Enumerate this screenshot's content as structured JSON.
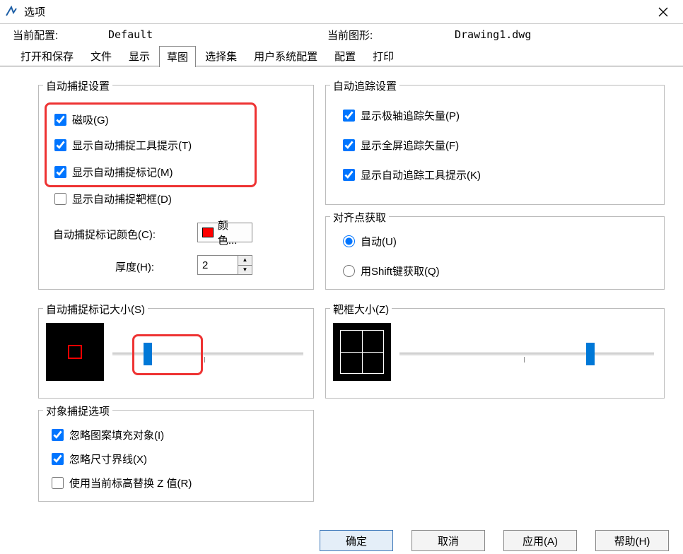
{
  "title": "选项",
  "config": {
    "label_current_profile": "当前配置:",
    "current_profile": "Default",
    "label_current_drawing": "当前图形:",
    "current_drawing": "Drawing1.dwg"
  },
  "tabs": [
    "打开和保存",
    "文件",
    "显示",
    "草图",
    "选择集",
    "用户系统配置",
    "配置",
    "打印"
  ],
  "active_tab": "草图",
  "group_autosnap": {
    "legend": "自动捕捉设置",
    "cb_magnet": "磁吸(G)",
    "cb_tooltip": "显示自动捕捉工具提示(T)",
    "cb_marker": "显示自动捕捉标记(M)",
    "cb_aperture": "显示自动捕捉靶框(D)",
    "label_color": "自动捕捉标记颜色(C):",
    "btn_color": "颜色...",
    "label_thickness": "厚度(H):",
    "thickness_value": "2"
  },
  "group_autotrack": {
    "legend": "自动追踪设置",
    "cb_polar": "显示极轴追踪矢量(P)",
    "cb_fullscreen": "显示全屏追踪矢量(F)",
    "cb_track_tooltip": "显示自动追踪工具提示(K)"
  },
  "group_align": {
    "legend": "对齐点获取",
    "rb_auto": "自动(U)",
    "rb_shift": "用Shift键获取(Q)"
  },
  "group_marker_size": {
    "legend": "自动捕捉标记大小(S)"
  },
  "group_aperture_size": {
    "legend": "靶框大小(Z)"
  },
  "group_objsnap": {
    "legend": "对象捕捉选项",
    "cb_ignore_hatch": "忽略图案填充对象(I)",
    "cb_ignore_dim": "忽略尺寸界线(X)",
    "cb_replace_z": "使用当前标高替换 Z 值(R)"
  },
  "buttons": {
    "ok": "确定",
    "cancel": "取消",
    "apply": "应用(A)",
    "help": "帮助(H)"
  }
}
